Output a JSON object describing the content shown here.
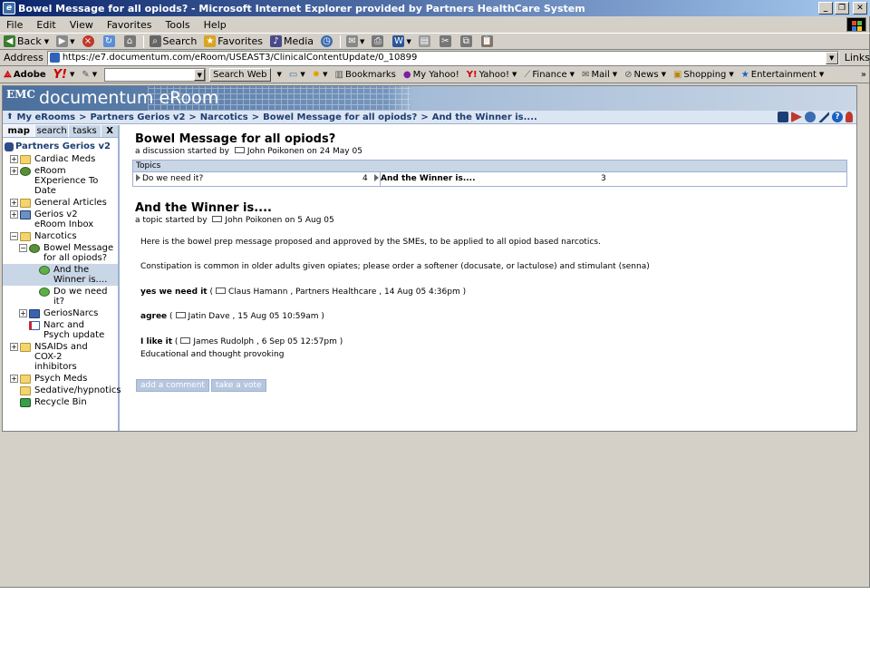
{
  "window": {
    "title": "Bowel Message for all opiods? - Microsoft Internet Explorer provided by Partners HealthCare System"
  },
  "menu": {
    "items": [
      "File",
      "Edit",
      "View",
      "Favorites",
      "Tools",
      "Help"
    ]
  },
  "toolbar": {
    "back": "Back",
    "search": "Search",
    "favorites": "Favorites",
    "media": "Media"
  },
  "address": {
    "label": "Address",
    "url": "https://e7.documentum.com/eRoom/USEAST3/ClinicalContentUpdate/0_10899",
    "links": "Links"
  },
  "yahoo_bar": {
    "adobe": "Adobe",
    "yahoo_logo": "Y!",
    "search_btn": "Search Web",
    "bookmarks": "Bookmarks",
    "my_yahoo": "My Yahoo!",
    "yahoo": "Yahoo!",
    "finance": "Finance",
    "mail": "Mail",
    "news": "News",
    "shopping": "Shopping",
    "entertainment": "Entertainment"
  },
  "banner": {
    "emc": "EMC",
    "product": "documentum eRoom"
  },
  "breadcrumb": [
    "My eRooms",
    "Partners Gerios v2",
    "Narcotics",
    "Bowel Message for all opiods?",
    "And the Winner is...."
  ],
  "left_tabs": {
    "map": "map",
    "search": "search",
    "tasks": "tasks",
    "close": "X"
  },
  "tree": {
    "root": "Partners Gerios v2",
    "items": [
      {
        "label": "Cardiac Meds"
      },
      {
        "label": "eRoom EXperience To Date"
      },
      {
        "label": "General Articles"
      },
      {
        "label": "Gerios v2 eRoom Inbox"
      },
      {
        "label": "Narcotics"
      },
      {
        "label": "Bowel Message for all opiods?"
      },
      {
        "label": "And the Winner is...."
      },
      {
        "label": "Do we need it?"
      },
      {
        "label": "GeriosNarcs"
      },
      {
        "label": "Narc and Psych update"
      },
      {
        "label": "NSAIDs and COX-2 inhibitors"
      },
      {
        "label": "Psych Meds"
      },
      {
        "label": "Sedative/hypnotics"
      },
      {
        "label": "Recycle Bin"
      }
    ]
  },
  "discussion": {
    "title": "Bowel Message for all opiods?",
    "started_by_prefix": "a discussion started by",
    "author": "John Poikonen",
    "date": "on 24 May 05",
    "topics_header": "Topics",
    "topics": [
      {
        "name": "Do we need it?",
        "count": "4"
      },
      {
        "name": "And the Winner is....",
        "count": "3"
      }
    ]
  },
  "topic": {
    "title": "And the Winner is....",
    "started_by_prefix": "a topic started by",
    "author": "John Poikonen",
    "date": "on 5 Aug 05",
    "body1": "Here is the bowel prep message proposed and approved by the SMEs, to be applied to all opiod based narcotics.",
    "body2": "Constipation is common in older adults given opiates; please order a softener (docusate, or lactulose) and stimulant (senna)",
    "replies": [
      {
        "text": "yes we need it",
        "meta": "Claus Hamann , Partners Healthcare , 14 Aug 05  4:36pm )"
      },
      {
        "text": "agree",
        "meta": "Jatin Dave , 15 Aug 05  10:59am )"
      },
      {
        "text": "I like it",
        "meta": "James Rudolph , 6 Sep 05  12:57pm )",
        "comment": "Educational and thought provoking"
      }
    ],
    "add_comment": "add a comment",
    "take_vote": "take a vote"
  },
  "colors": {
    "title_bar": "#0a246a",
    "pane_accent": "#c9d6e6",
    "link_blue": "#1d3e73"
  }
}
